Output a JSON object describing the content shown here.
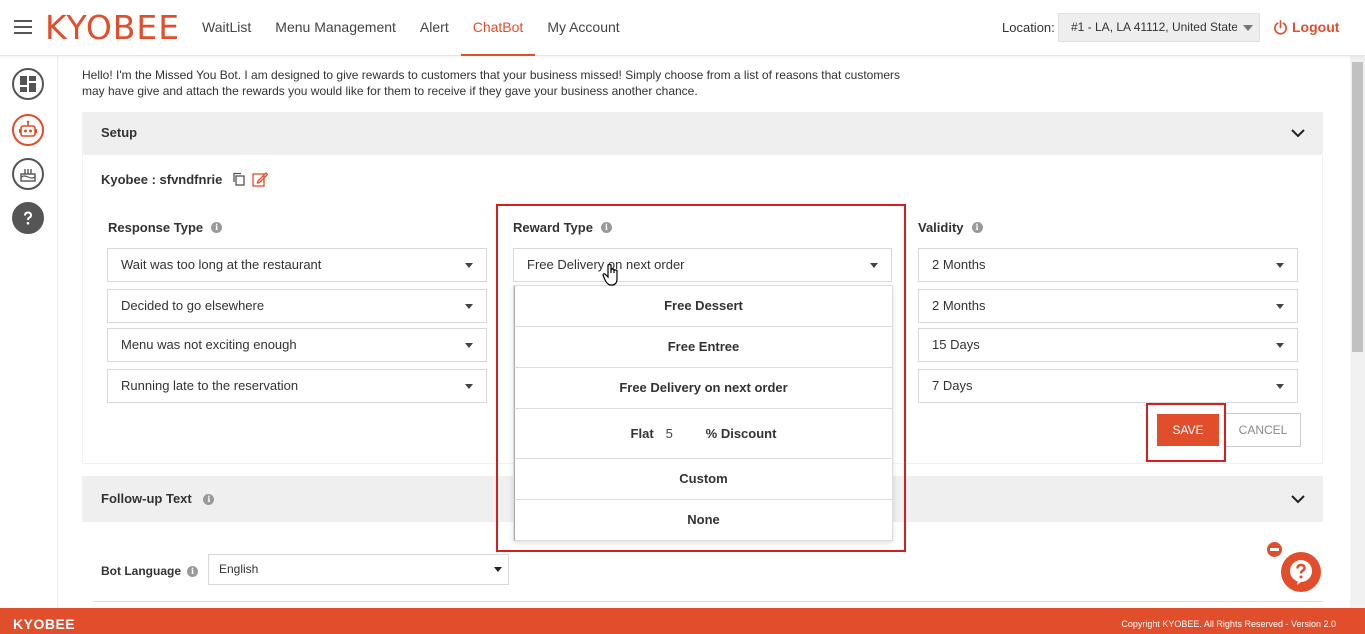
{
  "header": {
    "logo": "KYOBEE",
    "nav": [
      {
        "label": "WaitList"
      },
      {
        "label": "Menu Management"
      },
      {
        "label": "Alert"
      },
      {
        "label": "ChatBot",
        "active": true
      },
      {
        "label": "My Account"
      }
    ],
    "location_label": "Location:",
    "location_value": "#1 - LA, LA 41112, United States",
    "logout_label": "Logout"
  },
  "sidebar": {
    "items": [
      {
        "icon": "dashboard-icon"
      },
      {
        "icon": "robot-icon",
        "active": true
      },
      {
        "icon": "cake-icon"
      },
      {
        "icon": "question-icon"
      }
    ]
  },
  "intro_text": "Hello! I'm the Missed You Bot. I am designed to give rewards to customers that your business missed! Simply choose from a list of reasons that customers may have give and attach the rewards you would like for them to receive if they gave your business another chance.",
  "setup": {
    "title": "Setup",
    "bot_name": "Kyobee : sfvndfnrie",
    "columns": {
      "response_type": "Response Type",
      "reward_type": "Reward Type",
      "validity": "Validity"
    },
    "rows": [
      {
        "response": "Wait was too long at the restaurant",
        "reward": "Free Delivery on next order",
        "validity": "2 Months"
      },
      {
        "response": "Decided to go elsewhere",
        "validity": "2 Months"
      },
      {
        "response": "Menu was not exciting enough",
        "validity": "15 Days"
      },
      {
        "response": "Running late to the reservation",
        "validity": "7 Days"
      }
    ],
    "save_label": "SAVE",
    "cancel_label": "CANCEL"
  },
  "reward_dropdown": {
    "options": [
      "Free Dessert",
      "Free Entree",
      "Free Delivery on next order"
    ],
    "flat_prefix": "Flat",
    "flat_value": "5",
    "flat_suffix": "% Discount",
    "options_after": [
      "Custom",
      "None"
    ]
  },
  "followup": {
    "title": "Follow-up Text",
    "bot_language_label": "Bot Language",
    "bot_language_value": "English"
  },
  "footer": {
    "logo": "KYOBEE",
    "copyright": "Copyright KYOBEE. All Rights Reserved - Version 2.0"
  },
  "colors": {
    "brand": "#e04e2b",
    "highlight_box": "#d3201f"
  }
}
